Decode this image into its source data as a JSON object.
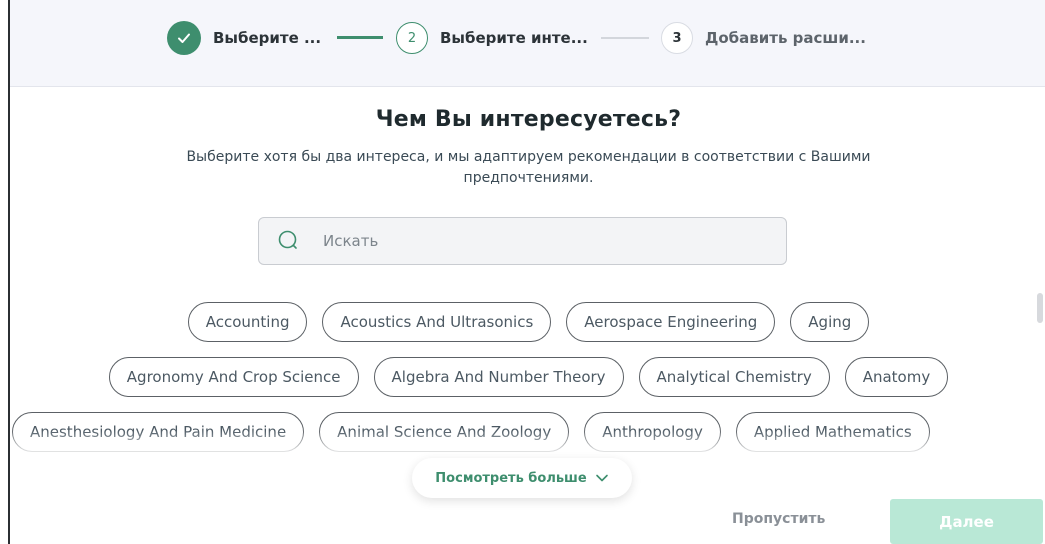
{
  "stepper": {
    "steps": [
      {
        "label": "Выберите ...",
        "number": "",
        "state": "done"
      },
      {
        "label": "Выберите инте...",
        "number": "2",
        "state": "active"
      },
      {
        "label": "Добавить расши...",
        "number": "3",
        "state": "pending"
      }
    ]
  },
  "heading": {
    "title": "Чем Вы интересуетесь?",
    "subtitle": "Выберите хотя бы два интереса, и мы адаптируем рекомендации в соответствии с Вашими предпочтениями."
  },
  "search": {
    "placeholder": "Искать",
    "value": ""
  },
  "interests": {
    "row1": [
      "Accounting",
      "Acoustics And Ultrasonics",
      "Aerospace Engineering",
      "Aging"
    ],
    "row2": [
      "Agronomy And Crop Science",
      "Algebra And Number Theory",
      "Analytical Chemistry",
      "Anatomy"
    ],
    "row3": [
      "Anesthesiology And Pain Medicine",
      "Animal Science And Zoology",
      "Anthropology",
      "Applied Mathematics"
    ]
  },
  "actions": {
    "see_more": "Посмотреть больше",
    "skip": "Пропустить",
    "next": "Далее"
  },
  "colors": {
    "accent": "#3e8e6e",
    "next_disabled": "#b9e8d6",
    "header_bg": "#f5f6fb"
  }
}
